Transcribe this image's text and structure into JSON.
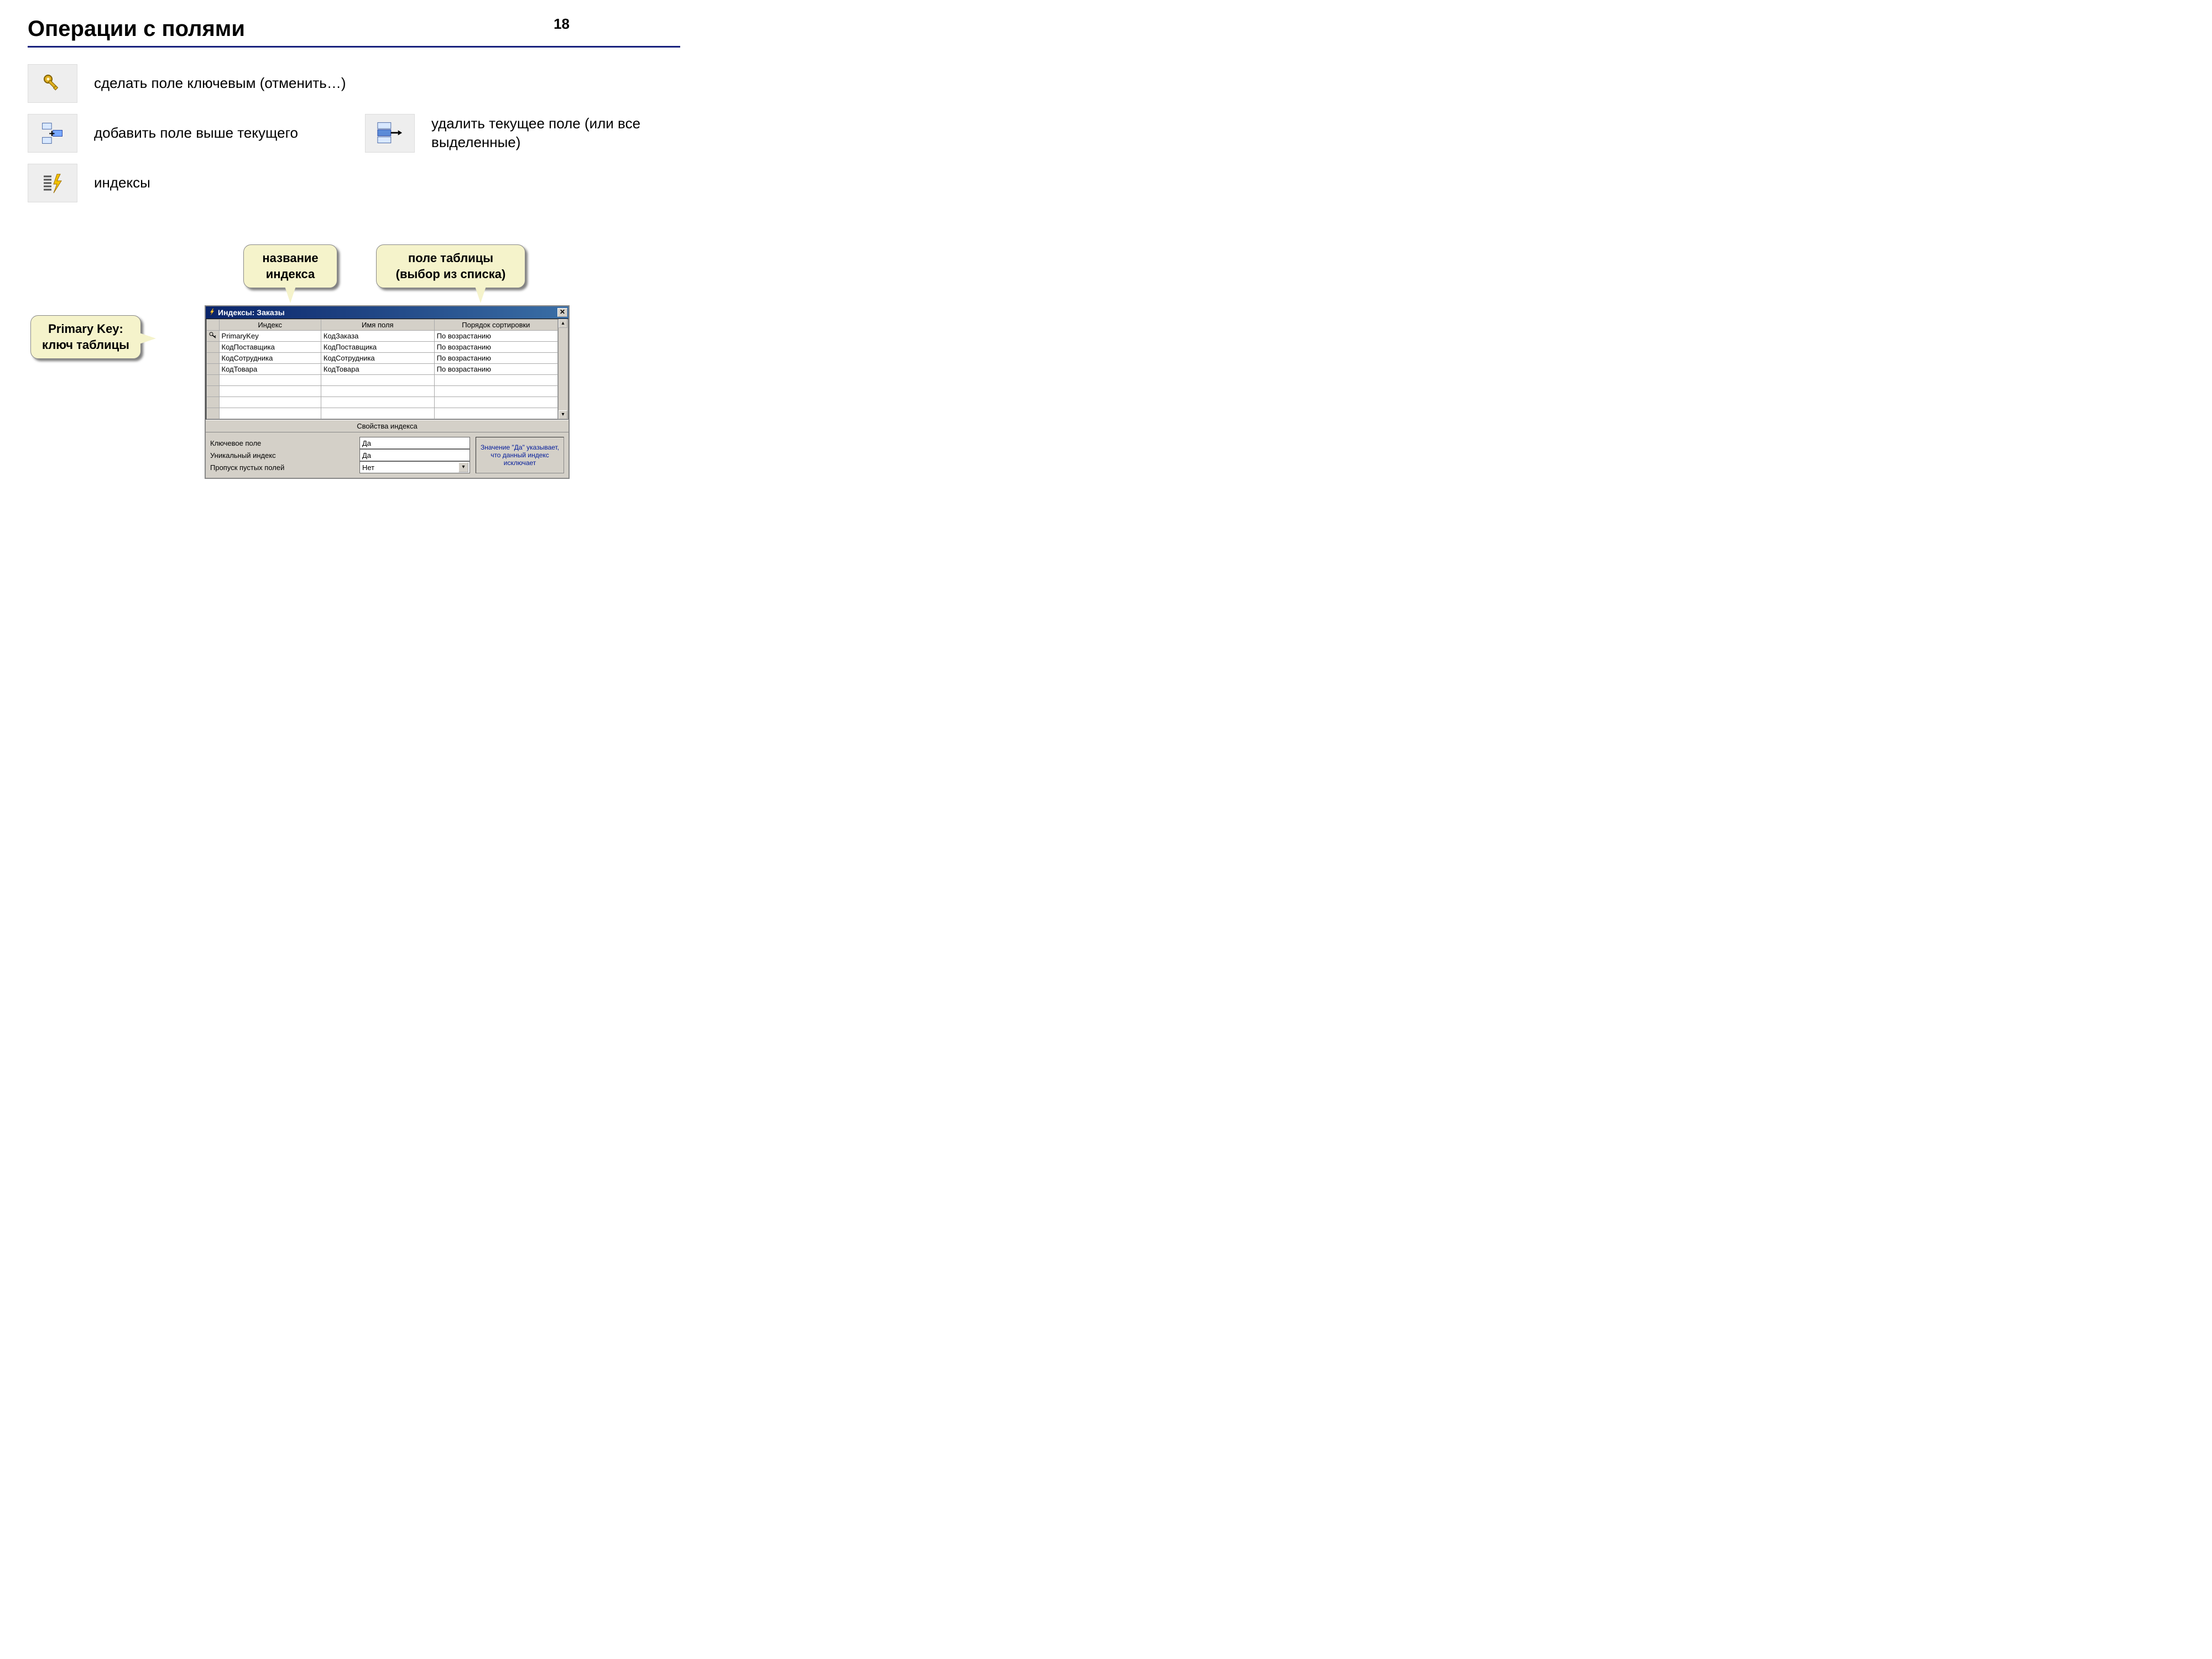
{
  "page_number": "18",
  "title": "Операции с полями",
  "items": {
    "make_key": "сделать поле ключевым (отменить…)",
    "add_field": "добавить поле выше текущего",
    "delete_field": "удалить текущее поле (или все выделенные)",
    "indexes": "индексы"
  },
  "callouts": {
    "index_name": "название индекса",
    "table_field": "поле таблицы (выбор из списка)",
    "primary_key": "Primary Key: ключ таблицы"
  },
  "window": {
    "title": "Индексы: Заказы",
    "columns": [
      "Индекс",
      "Имя поля",
      "Порядок сортировки"
    ],
    "rows": [
      {
        "key": true,
        "index": "PrimaryKey",
        "field": "КодЗаказа",
        "order": "По возрастанию"
      },
      {
        "key": false,
        "index": "КодПоставщика",
        "field": "КодПоставщика",
        "order": "По возрастанию"
      },
      {
        "key": false,
        "index": "КодСотрудника",
        "field": "КодСотрудника",
        "order": "По возрастанию"
      },
      {
        "key": false,
        "index": "КодТовара",
        "field": "КодТовара",
        "order": "По возрастанию"
      }
    ],
    "properties_header": "Свойства индекса",
    "properties": [
      {
        "label": "Ключевое поле",
        "value": "Да",
        "combo": false
      },
      {
        "label": "Уникальный индекс",
        "value": "Да",
        "combo": false
      },
      {
        "label": "Пропуск пустых полей",
        "value": "Нет",
        "combo": true
      }
    ],
    "help_text": "Значение \"Да\" указывает, что данный индекс исключает"
  }
}
